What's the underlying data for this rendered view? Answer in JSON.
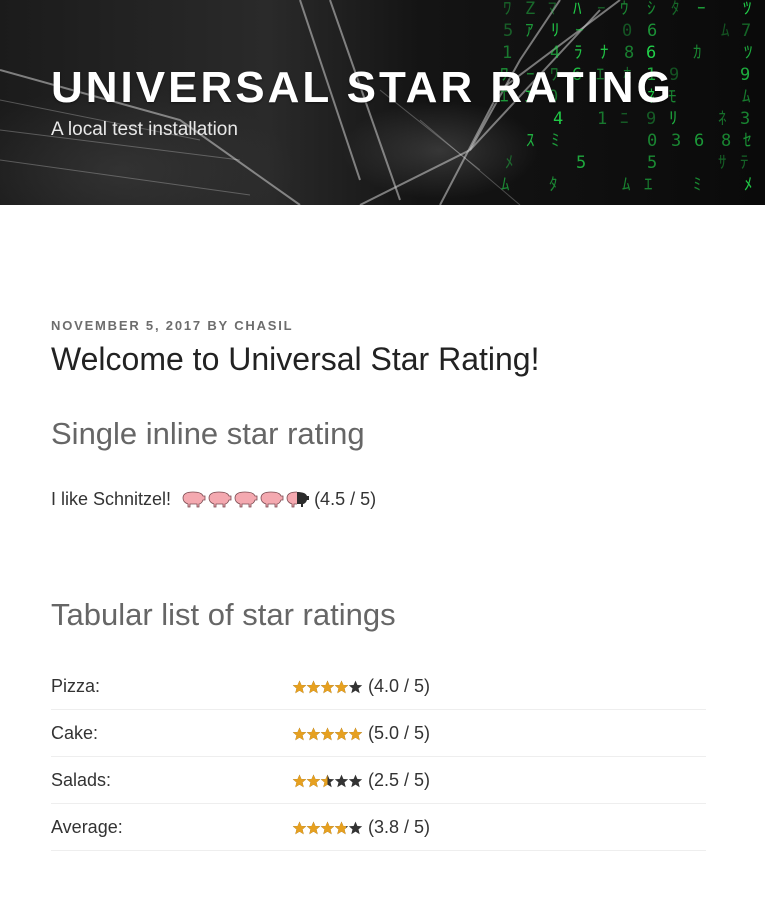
{
  "header": {
    "title": "UNIVERSAL STAR RATING",
    "description": "A local test installation"
  },
  "post": {
    "date": "NOVEMBER 5, 2017",
    "by": "BY",
    "author": "CHASIL",
    "title": "Welcome to Universal Star Rating!"
  },
  "single": {
    "heading": "Single inline star rating",
    "text": "I like Schnitzel!",
    "rating": 4.5,
    "max": 5,
    "score_text": "(4.5 / 5)",
    "icon": "pig-icon"
  },
  "table": {
    "heading": "Tabular list of star ratings",
    "rows": [
      {
        "label": "Pizza:",
        "rating": 4.0,
        "score_text": "(4.0 / 5)"
      },
      {
        "label": "Cake:",
        "rating": 5.0,
        "score_text": "(5.0 / 5)"
      },
      {
        "label": "Salads:",
        "rating": 2.5,
        "score_text": "(2.5 / 5)"
      }
    ],
    "average": {
      "label": "Average:",
      "rating": 3.8,
      "score_text": "(3.8 / 5)"
    }
  },
  "colors": {
    "star_filled": "#e6a020",
    "star_empty": "#333333",
    "pig_pink": "#f4a9b0",
    "pig_dark": "#2b2b2b"
  }
}
